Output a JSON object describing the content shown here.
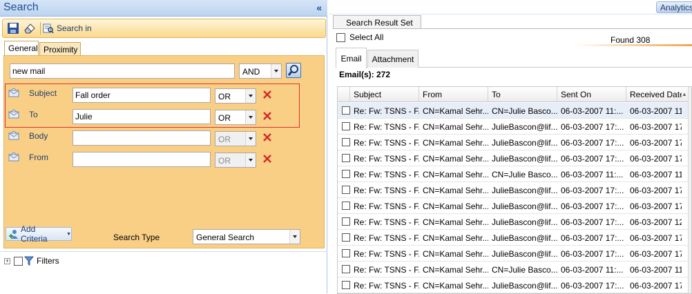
{
  "left": {
    "title": "Search",
    "collapse": "«",
    "toolbar": {
      "search_in": "Search in"
    },
    "tabs": [
      "General",
      "Proximity"
    ],
    "query": {
      "value": "new mail",
      "operator": "AND"
    },
    "criteria": [
      {
        "label": "Subject",
        "value": "Fall order",
        "op": "OR",
        "enabled": true
      },
      {
        "label": "To",
        "value": "Julie",
        "op": "OR",
        "enabled": true
      },
      {
        "label": "Body",
        "value": "",
        "op": "OR",
        "enabled": false
      },
      {
        "label": "From",
        "value": "",
        "op": "OR",
        "enabled": false
      }
    ],
    "add_criteria": "Add Criteria",
    "search_type_label": "Search Type",
    "search_type_value": "General Search",
    "filters_label": "Filters"
  },
  "right": {
    "analytics": "Analytics",
    "result_tab": "Search Result Set",
    "select_all": "Select All",
    "found": "Found 308",
    "mail_tabs": [
      "Email",
      "Attachment"
    ],
    "email_count": "Email(s):  272",
    "columns": [
      "Subject",
      "From",
      "To",
      "Sent On",
      "Received Date"
    ],
    "sort_indicator": "▲",
    "rows": [
      [
        "Re: Fw: TSNS - F...",
        "CN=Kamal Sehr...",
        "CN=Julie Basco...",
        "06-03-2007 11:...",
        "06-03-2007 11"
      ],
      [
        "Re: Fw: TSNS - F...",
        "CN=Kamal Sehr...",
        "JulieBascon@lif...",
        "06-03-2007 17:...",
        "06-03-2007 17"
      ],
      [
        "Re: Fw: TSNS - F...",
        "CN=Kamal Sehr...",
        "JulieBascon@lif...",
        "06-03-2007 17:...",
        "06-03-2007 17"
      ],
      [
        "Re: Fw: TSNS - F...",
        "CN=Kamal Sehr...",
        "JulieBascon@lif...",
        "06-03-2007 17:...",
        "06-03-2007 17"
      ],
      [
        "Re: Fw: TSNS - F...",
        "CN=Kamal Sehr...",
        "CN=Julie Basco...",
        "06-03-2007 11:...",
        "06-03-2007 11"
      ],
      [
        "Re: Fw: TSNS - F...",
        "CN=Kamal Sehr...",
        "JulieBascon@lif...",
        "06-03-2007 17:...",
        "06-03-2007 17"
      ],
      [
        "Re: Fw: TSNS - F...",
        "CN=Kamal Sehr...",
        "JulieBascon@lif...",
        "06-03-2007 17:...",
        "06-03-2007 17"
      ],
      [
        "Re: Fw: TSNS - F...",
        "CN=Kamal Sehr...",
        "JulieBascon@lif...",
        "06-03-2007 17:...",
        "06-03-2007 12"
      ],
      [
        "Re: Fw: TSNS - F...",
        "CN=Kamal Sehr...",
        "JulieBascon@lif...",
        "06-03-2007 17:...",
        "06-03-2007 17"
      ],
      [
        "Re: Fw: TSNS - F...",
        "CN=Kamal Sehr...",
        "JulieBascon@lif...",
        "06-03-2007 17:...",
        "06-03-2007 17"
      ],
      [
        "Re: Fw: TSNS - F...",
        "CN=Kamal Sehr...",
        "CN=Julie Basco...",
        "06-03-2007 11:...",
        "06-03-2007 11"
      ],
      [
        "Re: Fw: TSNS - F...",
        "CN=Kamal Sehr...",
        "JulieBascon@lif...",
        "06-03-2007 17:...",
        "06-03-2007 17"
      ]
    ]
  },
  "colors": {
    "panel": "#f9cf85",
    "toolbar": "#fbd98c",
    "title_text": "#1e4f93",
    "delete": "#d42a2a",
    "highlight_border": "#e03030"
  }
}
